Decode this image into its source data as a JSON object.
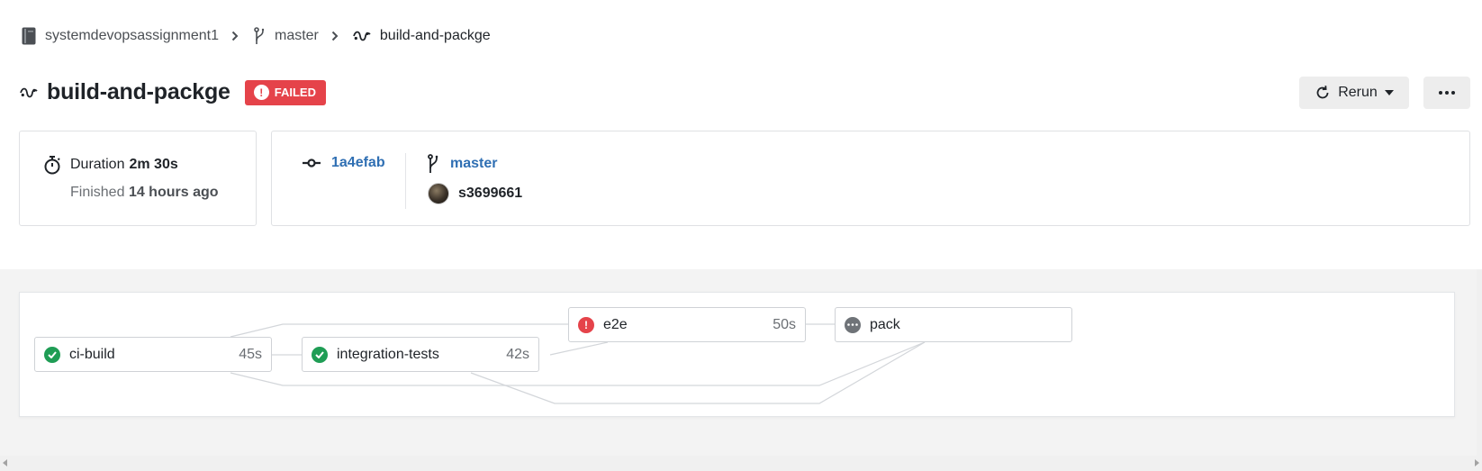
{
  "breadcrumb": {
    "repo": "systemdevopsassignment1",
    "branch": "master",
    "workflow": "build-and-packge"
  },
  "header": {
    "title": "build-and-packge",
    "status": "FAILED",
    "rerun_label": "Rerun"
  },
  "summary": {
    "duration_label": "Duration",
    "duration_value": "2m 30s",
    "finished_label": "Finished",
    "finished_value": "14 hours ago"
  },
  "commit": {
    "sha": "1a4efab",
    "branch": "master",
    "user": "s3699661"
  },
  "jobs": [
    {
      "name": "ci-build",
      "duration": "45s",
      "status": "success"
    },
    {
      "name": "integration-tests",
      "duration": "42s",
      "status": "success"
    },
    {
      "name": "e2e",
      "duration": "50s",
      "status": "failed"
    },
    {
      "name": "pack",
      "duration": "",
      "status": "not-run"
    }
  ],
  "colors": {
    "failed": "#e5434a",
    "success": "#1f9d55",
    "link": "#2f6fb3",
    "pending": "#6f7378"
  },
  "icons": {
    "repo": "repo-book-icon",
    "branch": "git-branch-icon",
    "workflow": "workflow-icon",
    "duration": "stopwatch-icon",
    "commit": "git-commit-icon",
    "rerun": "refresh-icon",
    "more": "ellipsis-icon"
  }
}
